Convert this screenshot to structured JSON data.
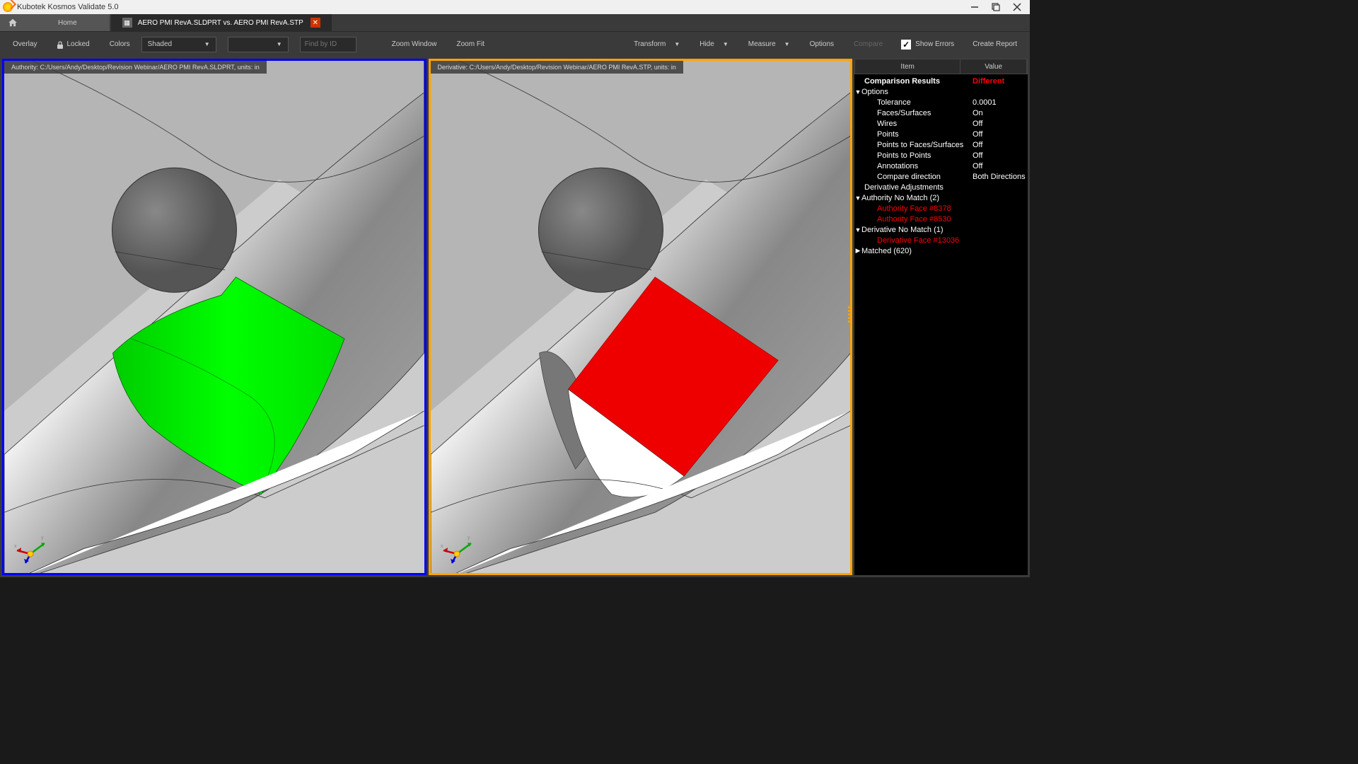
{
  "app": {
    "title": "Kubotek Kosmos Validate 5.0"
  },
  "tabs": {
    "home": "Home",
    "active": "AERO PMI RevA.SLDPRT vs. AERO PMI RevA.STP"
  },
  "toolbar": {
    "overlay": "Overlay",
    "locked": "Locked",
    "colors": "Colors",
    "shaded": "Shaded",
    "find_placeholder": "Find by ID",
    "zoom_window": "Zoom Window",
    "zoom_fit": "Zoom Fit",
    "transform": "Transform",
    "hide": "Hide",
    "measure": "Measure",
    "options": "Options",
    "compare": "Compare",
    "show_errors": "Show Errors",
    "create_report": "Create Report"
  },
  "viewport": {
    "authority": "Authority:  C:/Users/Andy/Desktop/Revision Webinar/AERO PMI RevA.SLDPRT, units: in",
    "derivative": "Derivative:  C:/Users/Andy/Desktop/Revision Webinar/AERO PMI RevA.STP, units: in"
  },
  "results": {
    "header_item": "Item",
    "header_value": "Value",
    "comparison_results": "Comparison Results",
    "comparison_value": "Different",
    "options_label": "Options",
    "tolerance": "Tolerance",
    "tolerance_val": "0.0001",
    "faces": "Faces/Surfaces",
    "faces_val": "On",
    "wires": "Wires",
    "wires_val": "Off",
    "points": "Points",
    "points_val": "Off",
    "points_faces": "Points to Faces/Surfaces",
    "points_faces_val": "Off",
    "points_points": "Points to Points",
    "points_points_val": "Off",
    "annotations": "Annotations",
    "annotations_val": "Off",
    "compare_dir": "Compare direction",
    "compare_dir_val": "Both Directions",
    "derivative_adj": "Derivative Adjustments",
    "authority_no_match": "Authority No Match (2)",
    "auth_face_1": "Authority Face #8378",
    "auth_face_2": "Authority Face #8530",
    "derivative_no_match": "Derivative No Match (1)",
    "deriv_face_1": "Derivative Face #13036",
    "matched": "Matched (620)"
  }
}
